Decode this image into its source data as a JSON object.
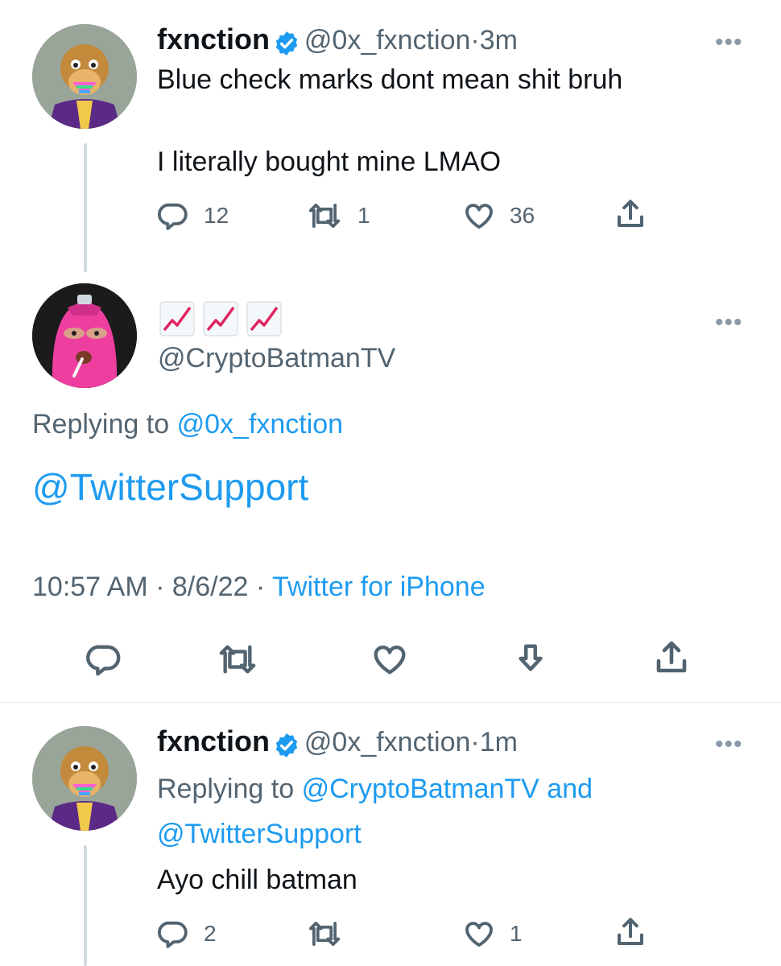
{
  "tweets": [
    {
      "name": "fxnction",
      "handle": "@0x_fxnction",
      "time": "3m",
      "lines": [
        "Blue check marks dont mean shit bruh",
        "I literally bought mine LMAO"
      ],
      "reply_count": "12",
      "retweet_count": "1",
      "like_count": "36"
    },
    {
      "handle": "@CryptoBatmanTV",
      "name_icons": [
        "chart-increasing-icon",
        "chart-increasing-icon",
        "chart-increasing-icon"
      ],
      "replying_prefix": "Replying to",
      "replying_to": "@0x_fxnction",
      "text": "@TwitterSupport",
      "timestamp": "10:57 AM",
      "date": "8/6/22",
      "source": "Twitter for iPhone"
    },
    {
      "name": "fxnction",
      "handle": "@0x_fxnction",
      "time": "1m",
      "replying_prefix": "Replying to",
      "replying_to_1": "@CryptoBatmanTV",
      "replying_and": "and",
      "replying_to_2": "@TwitterSupport",
      "text": "Ayo chill batman",
      "reply_count": "2",
      "like_count": "1"
    }
  ],
  "separator": "·",
  "colors": {
    "accent": "#1d9bf0",
    "secondary": "#536471",
    "primary": "#0f1419",
    "trend_red": "#e0245e"
  }
}
